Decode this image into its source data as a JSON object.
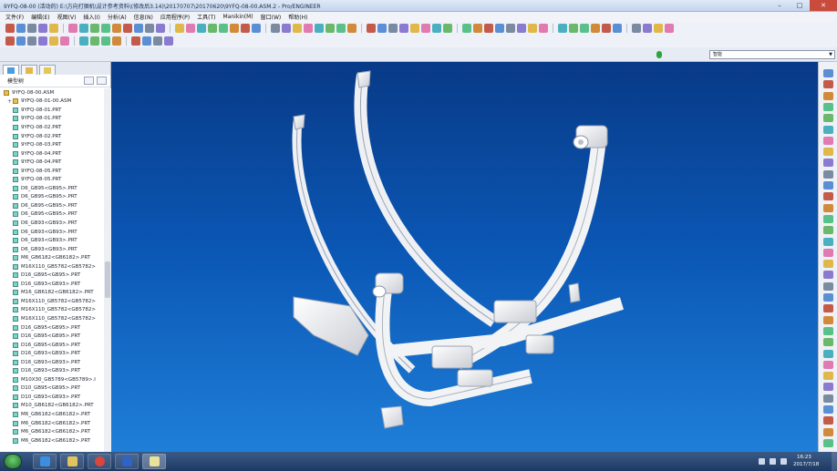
{
  "window": {
    "title": "9YFQ-08-00 (活动的) E:\\方向打捆机\\设计参考资料\\(修改后3.14)\\20170707\\20170620\\9YFQ-08-00.ASM.2 - Pro/ENGINEER",
    "minimize": "–",
    "maximize": "□",
    "close": "✕"
  },
  "menubar": {
    "items": [
      "文件(F)",
      "编辑(E)",
      "视图(V)",
      "插入(I)",
      "分析(A)",
      "信息(N)",
      "应用程序(P)",
      "工具(T)",
      "Manikin(M)",
      "窗口(W)",
      "帮助(H)"
    ]
  },
  "statusrow": {
    "filter_value": "智能"
  },
  "model_tree": {
    "header": "模型树",
    "items": [
      {
        "label": "9YFQ-08-00.ASM",
        "type": "asm",
        "level": 0
      },
      {
        "label": "9YFQ-08-01-00.ASM",
        "type": "asm",
        "level": 1,
        "expandable": true
      },
      {
        "label": "9YFQ-08-01.PRT",
        "type": "prt",
        "level": 1
      },
      {
        "label": "9YFQ-08-01.PRT",
        "type": "prt",
        "level": 1
      },
      {
        "label": "9YFQ-08-02.PRT",
        "type": "prt",
        "level": 1
      },
      {
        "label": "9YFQ-08-02.PRT",
        "type": "prt",
        "level": 1
      },
      {
        "label": "9YFQ-08-03.PRT",
        "type": "prt",
        "level": 1
      },
      {
        "label": "9YFQ-08-04.PRT",
        "type": "prt",
        "level": 1
      },
      {
        "label": "9YFQ-08-04.PRT",
        "type": "prt",
        "level": 1
      },
      {
        "label": "9YFQ-08-05.PRT",
        "type": "prt",
        "level": 1
      },
      {
        "label": "9YFQ-08-05.PRT",
        "type": "prt",
        "level": 1
      },
      {
        "label": "D6_GB95<GB95>.PRT",
        "type": "prt",
        "level": 1
      },
      {
        "label": "D6_GB95<GB95>.PRT",
        "type": "prt",
        "level": 1
      },
      {
        "label": "D6_GB95<GB95>.PRT",
        "type": "prt",
        "level": 1
      },
      {
        "label": "D6_GB95<GB95>.PRT",
        "type": "prt",
        "level": 1
      },
      {
        "label": "D6_GB93<GB93>.PRT",
        "type": "prt",
        "level": 1
      },
      {
        "label": "D6_GB93<GB93>.PRT",
        "type": "prt",
        "level": 1
      },
      {
        "label": "D6_GB93<GB93>.PRT",
        "type": "prt",
        "level": 1
      },
      {
        "label": "D6_GB93<GB93>.PRT",
        "type": "prt",
        "level": 1
      },
      {
        "label": "M6_GB6182<GB6182>.PRT",
        "type": "prt",
        "level": 1
      },
      {
        "label": "M16X110_GB5782<GB5782>",
        "type": "prt",
        "level": 1
      },
      {
        "label": "D16_GB95<GB95>.PRT",
        "type": "prt",
        "level": 1
      },
      {
        "label": "D16_GB93<GB93>.PRT",
        "type": "prt",
        "level": 1
      },
      {
        "label": "M16_GB6182<GB6182>.PRT",
        "type": "prt",
        "level": 1
      },
      {
        "label": "M16X110_GB5782<GB5782>",
        "type": "prt",
        "level": 1
      },
      {
        "label": "M16X110_GB5782<GB5782>",
        "type": "prt",
        "level": 1
      },
      {
        "label": "M16X110_GB5782<GB5782>",
        "type": "prt",
        "level": 1
      },
      {
        "label": "D16_GB95<GB95>.PRT",
        "type": "prt",
        "level": 1
      },
      {
        "label": "D16_GB95<GB95>.PRT",
        "type": "prt",
        "level": 1
      },
      {
        "label": "D16_GB95<GB95>.PRT",
        "type": "prt",
        "level": 1
      },
      {
        "label": "D16_GB93<GB93>.PRT",
        "type": "prt",
        "level": 1
      },
      {
        "label": "D16_GB93<GB93>.PRT",
        "type": "prt",
        "level": 1
      },
      {
        "label": "D16_GB93<GB93>.PRT",
        "type": "prt",
        "level": 1
      },
      {
        "label": "M10X30_GB5789<GB5789>.I",
        "type": "prt",
        "level": 1
      },
      {
        "label": "D10_GB95<GB95>.PRT",
        "type": "prt",
        "level": 1
      },
      {
        "label": "D10_GB93<GB93>.PRT",
        "type": "prt",
        "level": 1
      },
      {
        "label": "M10_GB6182<GB6182>.PRT",
        "type": "prt",
        "level": 1
      },
      {
        "label": "M6_GB6182<GB6182>.PRT",
        "type": "prt",
        "level": 1
      },
      {
        "label": "M6_GB6182<GB6182>.PRT",
        "type": "prt",
        "level": 1
      },
      {
        "label": "M6_GB6182<GB6182>.PRT",
        "type": "prt",
        "level": 1
      },
      {
        "label": "M6_GB6182<GB6182>.PRT",
        "type": "prt",
        "level": 1
      }
    ]
  },
  "taskbar": {
    "time": "16:23",
    "date": "2017/7/18"
  },
  "colors": {
    "viewport_top": "#083a87",
    "viewport_bottom": "#1f7fd8",
    "model": "#f2f3f5"
  }
}
